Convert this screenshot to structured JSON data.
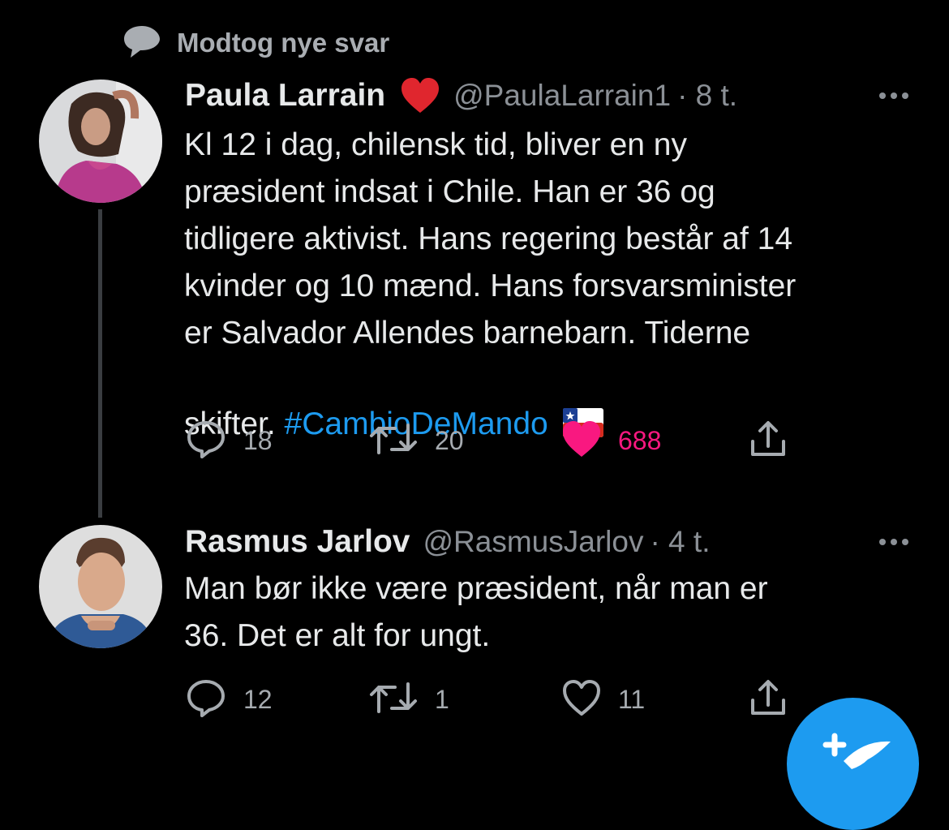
{
  "notice": {
    "text": "Modtog nye svar",
    "icon": "speech-bubble-icon"
  },
  "tweets": [
    {
      "name": "Paula Larrain",
      "emoji": "❤️",
      "handle": "@PaulaLarrain1",
      "time": "· 8 t.",
      "text": "Kl 12 i dag, chilensk tid, bliver en ny\npræsident indsat i Chile. Han er 36 og\ntidligere aktivist. Hans regering består af 14\nkvinder og 10 mænd. Hans forsvarsminister\ner Salvador Allendes barnebarn. Tiderne\nskifter.  ",
      "hashtag": "#CambioDeMando",
      "flag": "chile-flag",
      "replies": "18",
      "retweets": "20",
      "likes": "688",
      "liked": true
    },
    {
      "name": "Rasmus Jarlov",
      "handle": "@RasmusJarlov",
      "time": "· 4 t.",
      "text": "Man bør ikke være præsident, når man er\n36. Det er alt for ungt.",
      "replies": "12",
      "retweets": "1",
      "likes": "11",
      "liked": false
    }
  ],
  "colors": {
    "accent": "#1d9bf0",
    "like": "#f91880",
    "muted": "#8b9096"
  }
}
